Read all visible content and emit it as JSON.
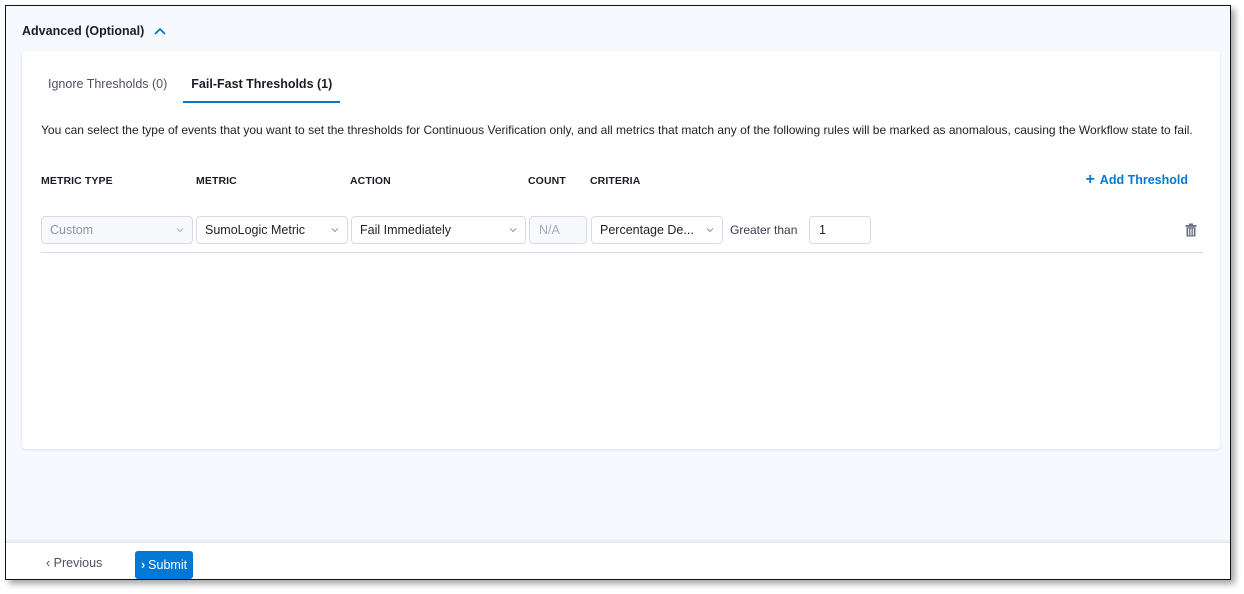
{
  "section": {
    "title": "Advanced (Optional)",
    "toggle_icon": "chevron-up-icon"
  },
  "tabs": [
    {
      "label": "Ignore Thresholds (0)",
      "active": false
    },
    {
      "label": "Fail-Fast Thresholds (1)",
      "active": true
    }
  ],
  "description": "You can select the type of events that you want to set the thresholds for Continuous Verification only, and all metrics that match any of the following rules will be marked as anomalous, causing the Workflow state to fail.",
  "table": {
    "headers": [
      "METRIC TYPE",
      "METRIC",
      "ACTION",
      "COUNT",
      "CRITERIA"
    ],
    "add_label": "Add Threshold",
    "rows": [
      {
        "metric_type": "Custom",
        "metric": "SumoLogic Metric",
        "action": "Fail Immediately",
        "count_placeholder": "N/A",
        "criteria": "Percentage De...",
        "comparator": "Greater than",
        "value": "1"
      }
    ]
  },
  "footer": {
    "previous_label": "Previous",
    "submit_label": "Submit"
  },
  "colors": {
    "accent": "#0278d5",
    "background": "#f6f9fd",
    "border": "#d9dae5"
  }
}
